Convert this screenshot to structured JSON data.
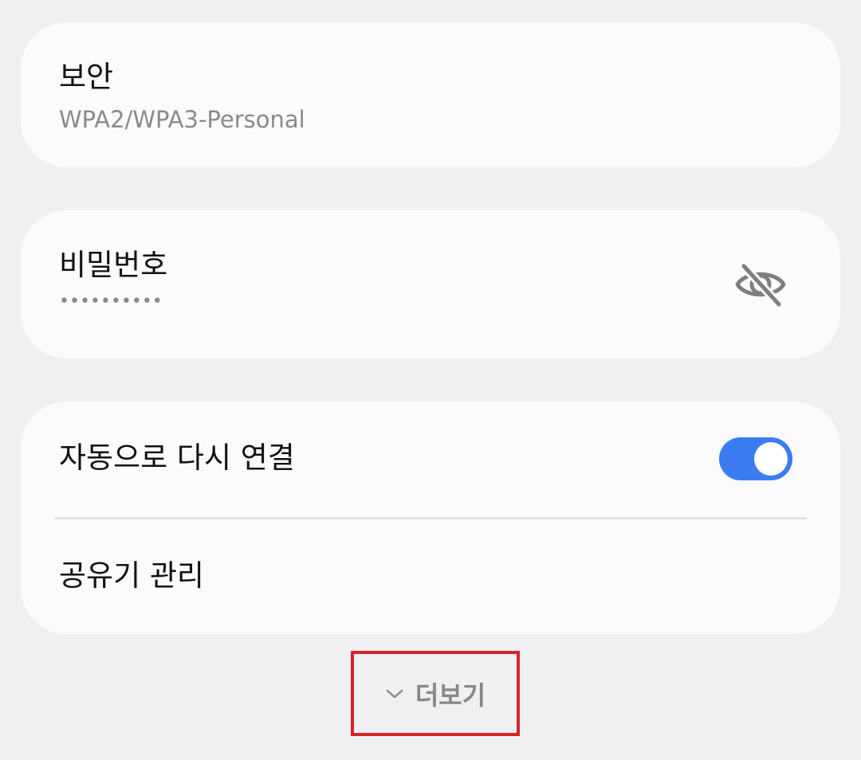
{
  "security": {
    "title": "보안",
    "value": "WPA2/WPA3-Personal"
  },
  "password": {
    "title": "비밀번호",
    "masked_value": "••••••••••",
    "visibility_icon": "eye-off-icon"
  },
  "options": {
    "auto_reconnect": {
      "label": "자동으로 다시 연결",
      "enabled": true
    },
    "router_manage": {
      "label": "공유기 관리"
    }
  },
  "more": {
    "label": "더보기",
    "icon": "chevron-down-icon"
  },
  "colors": {
    "background": "#f0f0f3",
    "card": "#fbfbfd",
    "accent": "#3b7cf3",
    "highlight_box": "#d8232a",
    "secondary_text": "#8a8a8a"
  }
}
